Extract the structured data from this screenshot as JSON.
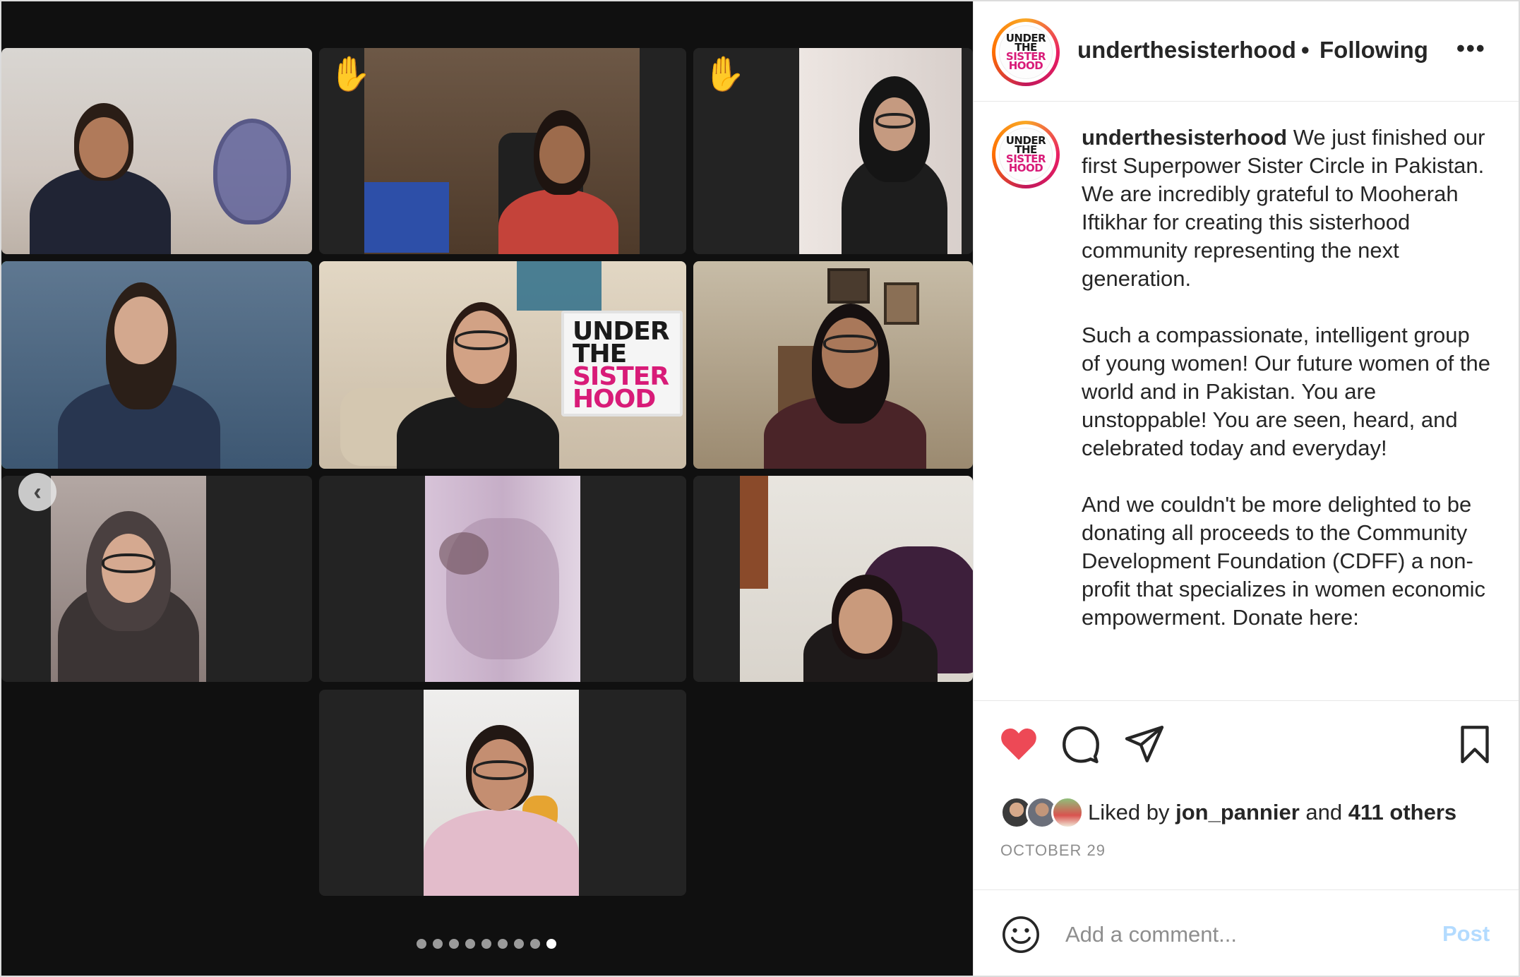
{
  "post": {
    "username": "underthesisterhood",
    "separator": "•",
    "follow_status": "Following",
    "more_label": "•••",
    "avatar_logo": [
      "UNDER",
      "THE",
      "SISTER",
      "HOOD"
    ],
    "caption": {
      "username": "underthesisterhood",
      "paragraphs": [
        "We just finished our first Superpower Sister Circle in Pakistan. We are incredibly grateful to Mooherah Iftikhar for creating this sisterhood community representing the next generation.",
        "Such a compassionate, intelligent group of young women! Our future women of the world and in Pakistan. You are unstoppable! You are seen, heard, and celebrated today and everyday!",
        "And we couldn't be more delighted to be donating all proceeds to the Community Development Foundation (CDFF) a non-profit that specializes in women economic empowerment. Donate here:"
      ]
    },
    "liked_prefix": "Liked by",
    "liked_user": "jon_pannier",
    "liked_and": "and",
    "liked_others": "411 others",
    "date": "OCTOBER 29",
    "liked": true
  },
  "comment": {
    "placeholder": "Add a comment...",
    "post_label": "Post"
  },
  "icons": {
    "heart": "heart-icon",
    "comment": "comment-icon",
    "share": "share-icon",
    "save": "bookmark-icon",
    "emoji": "emoji-icon",
    "prev": "chevron-left-icon",
    "raise_hand": "raised-hand-icon"
  },
  "media": {
    "sign_text": [
      "UNDER",
      "THE",
      "SISTER",
      "HOOD"
    ],
    "carousel": {
      "total": 9,
      "current": 9
    },
    "prev_glyph": "‹",
    "raise_hand_glyph": "✋"
  },
  "colors": {
    "heart": "#ed4956",
    "link_blue_disabled": "#b3dbff",
    "speaking_border": "#54d244",
    "brand_pink": "#d81b78"
  }
}
